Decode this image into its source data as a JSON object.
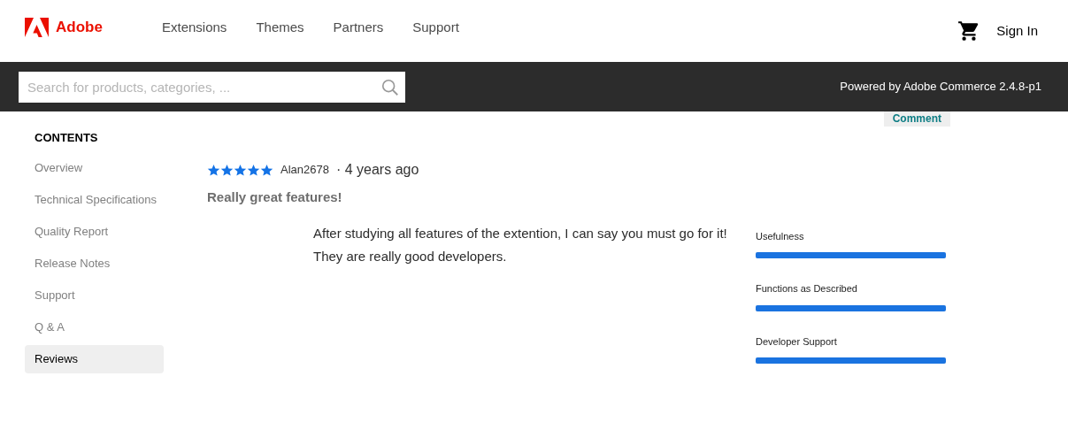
{
  "header": {
    "logo": "Adobe",
    "nav": [
      "Extensions",
      "Themes",
      "Partners",
      "Support"
    ],
    "sign_in": "Sign In"
  },
  "search_bar": {
    "placeholder": "Search for products, categories, ...",
    "powered_by": "Powered by Adobe Commerce 2.4.8-p1"
  },
  "comment_button": "Comment",
  "sidebar": {
    "title": "CONTENTS",
    "items": [
      {
        "label": "Overview",
        "selected": false
      },
      {
        "label": "Technical Specifications",
        "selected": false
      },
      {
        "label": "Quality Report",
        "selected": false
      },
      {
        "label": "Release Notes",
        "selected": false
      },
      {
        "label": "Support",
        "selected": false
      },
      {
        "label": "Q & A",
        "selected": false
      },
      {
        "label": "Reviews",
        "selected": true
      }
    ]
  },
  "review": {
    "stars": 5,
    "author": "Alan2678",
    "age": "· 4 years ago",
    "title": "Really great features!",
    "body": [
      "After studying all features of the extention, I can say you must go for it!",
      "They are really good developers."
    ],
    "ratings": [
      {
        "label": "Usefulness",
        "level": 1
      },
      {
        "label": "Functions as Described",
        "level": 1
      },
      {
        "label": "Developer Support",
        "level": 1
      }
    ]
  }
}
